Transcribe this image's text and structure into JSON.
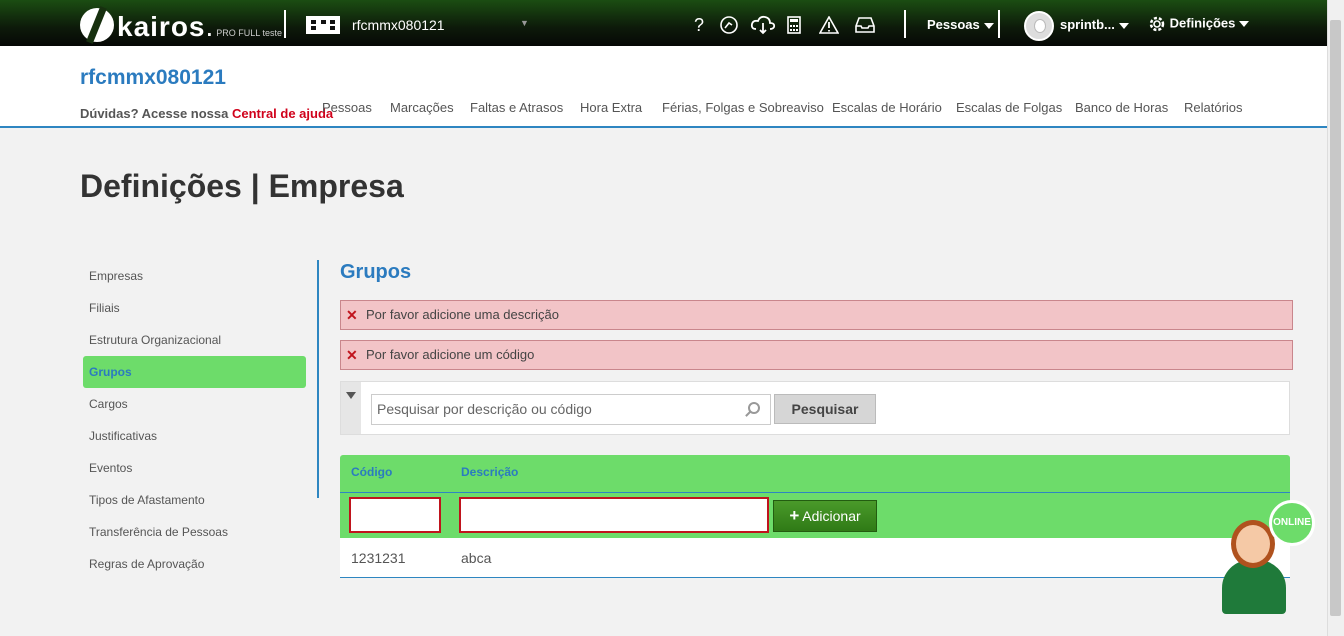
{
  "topbar": {
    "logo_text": "kairos",
    "logo_sub": "PRO FULL teste",
    "company_name": "rfcmmx080121",
    "menu_pessoas": "Pessoas",
    "user_name": "sprintb...",
    "menu_definicoes": "Definições",
    "icons": [
      "help-icon",
      "support-icon",
      "cloud-download-icon",
      "calculator-icon",
      "warning-icon",
      "inbox-icon"
    ]
  },
  "subheader": {
    "title": "rfcmmx080121",
    "help_text": "Dúvidas? Acesse nossa",
    "help_link": "Central de ajuda",
    "tabs": [
      "Pessoas",
      "Marcações",
      "Faltas e Atrasos",
      "Hora Extra",
      "Férias, Folgas e Sobreaviso",
      "Escalas de Horário",
      "Escalas de Folgas",
      "Banco de Horas",
      "Relatórios"
    ]
  },
  "page": {
    "title": "Definições | Empresa"
  },
  "sidebar": {
    "items": [
      "Empresas",
      "Filiais",
      "Estrutura Organizacional",
      "Grupos",
      "Cargos",
      "Justificativas",
      "Eventos",
      "Tipos de Afastamento",
      "Transferência de Pessoas",
      "Regras de Aprovação"
    ],
    "active": "Grupos"
  },
  "main": {
    "section_title": "Grupos",
    "alerts": [
      "Por favor adicione uma descrição",
      "Por favor adicione um código"
    ],
    "search_placeholder": "Pesquisar por descrição ou código",
    "search_button": "Pesquisar",
    "table": {
      "headers": [
        "Código",
        "Descrição"
      ],
      "add_button": "Adicionar",
      "rows": [
        {
          "codigo": "1231231",
          "descricao": "abca"
        }
      ]
    }
  },
  "chat": {
    "status": "ONLINE"
  },
  "colors": {
    "accent_green": "#6ddc6a",
    "accent_blue": "#2b7bbf",
    "error_red": "#c0141d"
  }
}
